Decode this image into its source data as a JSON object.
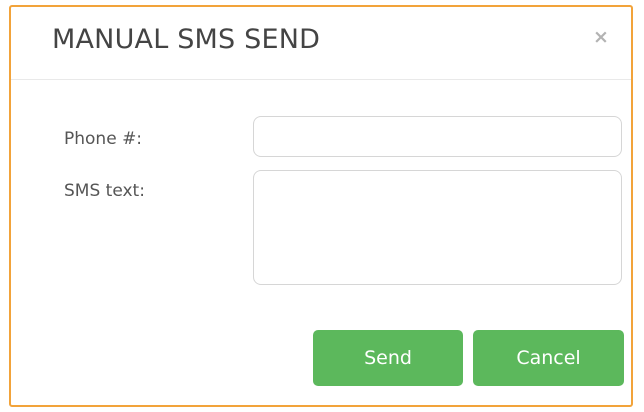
{
  "dialog": {
    "title": "MANUAL SMS SEND",
    "close_glyph": "×",
    "close_icon": "close-icon"
  },
  "form": {
    "phone": {
      "label": "Phone #:",
      "value": "",
      "placeholder": ""
    },
    "sms": {
      "label": "SMS text:",
      "value": "",
      "placeholder": ""
    }
  },
  "actions": {
    "send_label": "Send",
    "cancel_label": "Cancel"
  },
  "colors": {
    "accent_border": "#f2a33a",
    "button_green": "#5cb85c",
    "button_text": "#ffffff",
    "title_text": "#444444",
    "close_icon": "#b3b3b3"
  }
}
